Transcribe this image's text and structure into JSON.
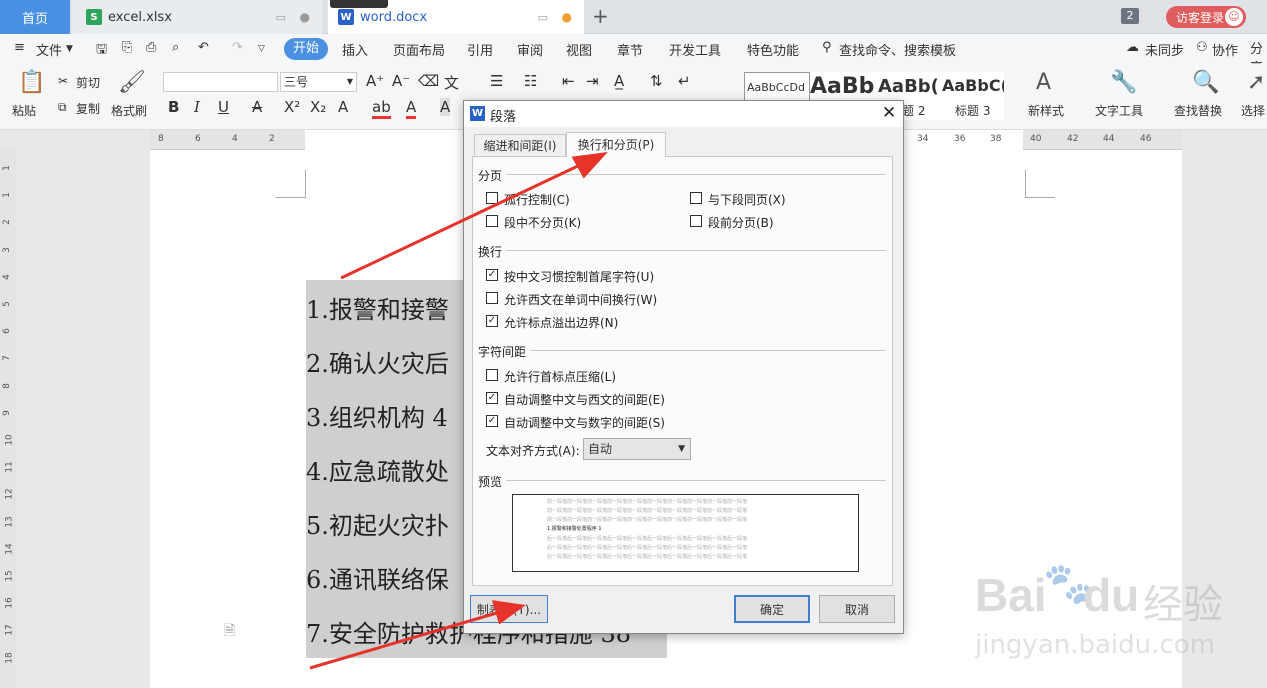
{
  "tabs": {
    "home": "首页",
    "excel": "excel.xlsx",
    "word": "word.docx",
    "window_count": "2",
    "login": "访客登录"
  },
  "menu": {
    "file": "文件",
    "start": "开始",
    "insert": "插入",
    "layout": "页面布局",
    "reference": "引用",
    "review": "审阅",
    "view": "视图",
    "chapter": "章节",
    "devtools": "开发工具",
    "special": "特色功能",
    "search": "查找命令、搜索模板",
    "sync": "未同步",
    "collab": "协作",
    "share": "分享"
  },
  "ribbon": {
    "paste": "粘贴",
    "cut": "剪切",
    "copy": "复制",
    "format_painter": "格式刷",
    "font_size": "三号",
    "style1": "AaBbCcDd",
    "style2": "AaBb",
    "style3": "AaBb(",
    "style4": "AaBbC(",
    "style3_label": "题 2",
    "style4_label": "标题 3",
    "new_style": "新样式",
    "text_tools": "文字工具",
    "find_replace": "查找替换",
    "select": "选择"
  },
  "ruler": {
    "left": [
      "8",
      "6",
      "4",
      "2"
    ],
    "right": [
      "34",
      "36",
      "38",
      "40",
      "42",
      "44",
      "46"
    ],
    "vertical": [
      "1",
      "1",
      "2",
      "3",
      "4",
      "5",
      "6",
      "7",
      "8",
      "9",
      "10",
      "11",
      "12",
      "13",
      "14",
      "15",
      "16",
      "17",
      "18"
    ]
  },
  "document": {
    "lines": [
      "1.报警和接警",
      "2.确认火灾后",
      "3.组织机构 4",
      "4.应急疏散处",
      "5.初起火灾扑",
      "6.通讯联络保",
      "7.安全防护救护程序和措施 38"
    ]
  },
  "dialog": {
    "title": "段落",
    "tab_indent": "缩进和间距(I)",
    "tab_break": "换行和分页(P)",
    "sec_pagination": "分页",
    "widow": "孤行控制(C)",
    "keep_next": "与下段同页(X)",
    "keep_lines": "段中不分页(K)",
    "page_break_before": "段前分页(B)",
    "sec_linebreak": "换行",
    "cjk_rules": "按中文习惯控制首尾字符(U)",
    "word_wrap": "允许西文在单词中间换行(W)",
    "punct_overflow": "允许标点溢出边界(N)",
    "sec_charspacing": "字符间距",
    "compress_punct": "允许行首标点压缩(L)",
    "auto_cn_en": "自动调整中文与西文的间距(E)",
    "auto_cn_num": "自动调整中文与数字的间距(S)",
    "text_align_label": "文本对齐方式(A):",
    "text_align_value": "自动",
    "sec_preview": "预览",
    "preview_prev": "前一段落前一段落前一段落前一段落前一段落前一段落前一段落前一段落前一段落前一段落",
    "preview_current": "1.报警和接警处置程序 1",
    "preview_next": "后一段落后一段落后一段落后一段落后一段落后一段落后一段落后一段落后一段落后一段落",
    "tabs_button": "制表位(T)...",
    "ok": "确定",
    "cancel": "取消",
    "checked": {
      "widow": false,
      "keep_next": false,
      "keep_lines": false,
      "page_break_before": false,
      "cjk_rules": true,
      "word_wrap": false,
      "punct_overflow": true,
      "compress_punct": false,
      "auto_cn_en": true,
      "auto_cn_num": true
    }
  },
  "watermark": {
    "brand": "Bai",
    "brand2": "du",
    "cn": "经验",
    "url": "jingyan.baidu.com"
  },
  "colors": {
    "accent": "#4a90e2",
    "arrow": "#e8332a",
    "login": "#e05d5d"
  }
}
